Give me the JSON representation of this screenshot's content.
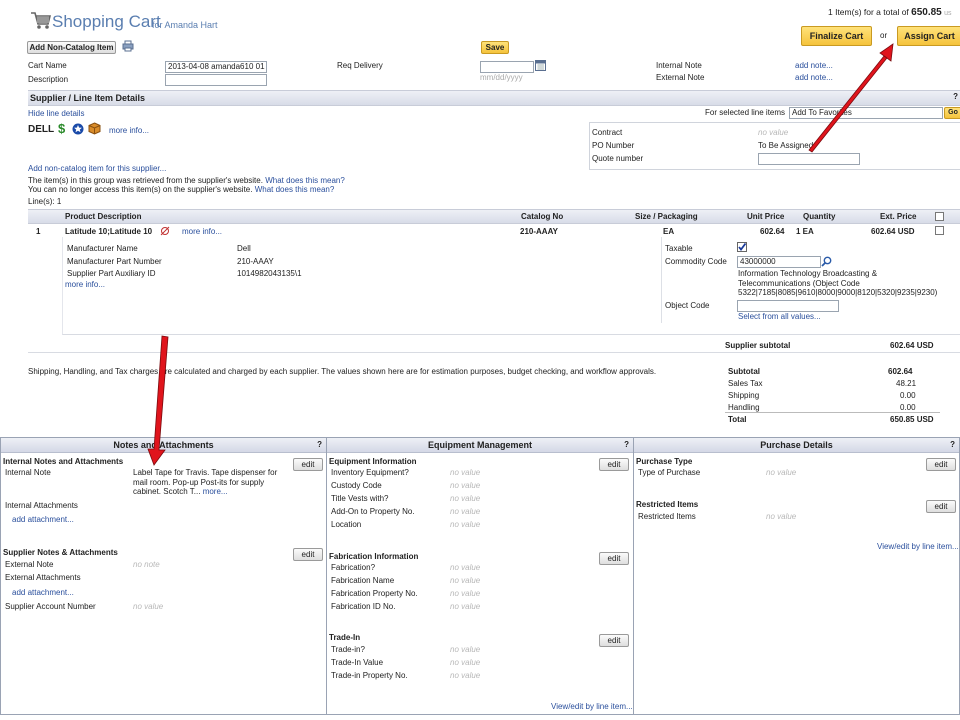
{
  "header": {
    "title": "Shopping Cart",
    "user": "for Amanda Hart",
    "summary_prefix": "1 Item(s)  for a total of",
    "total": "650.85",
    "currency": "us",
    "finalize_label": "Finalize Cart",
    "or": "or",
    "assign_label": "Assign Cart",
    "add_noncatalog_label": "Add Non-Catalog Item",
    "save_label": "Save"
  },
  "cart_form": {
    "cart_name_label": "Cart Name",
    "cart_name_value": "2013-04-08 amanda610 01",
    "description_label": "Description",
    "description_value": "",
    "req_delivery_label": "Req Delivery",
    "date_hint": "mm/dd/yyyy",
    "internal_note_label": "Internal Note",
    "external_note_label": "External Note",
    "add_note": "add note..."
  },
  "supplier_section": {
    "title": "Supplier / Line Item Details",
    "hide_link": "Hide line details",
    "selected_label": "For selected line items",
    "select_value": "Add To Favorites",
    "go_label": "Go",
    "supplier_name": "DELL",
    "more_info": "more info...",
    "add_noncat_link": "Add non-catalog item for this supplier...",
    "notice1": "The item(s) in this group was retrieved from the supplier's website.",
    "notice2": "You can no longer access this item(s) on the supplier's website.",
    "what_link": "What does this mean?",
    "lines": "Line(s): 1",
    "contract_label": "Contract",
    "contract_value": "no value",
    "po_label": "PO Number",
    "po_value": "To Be Assigned",
    "quote_label": "Quote number"
  },
  "table": {
    "headers": [
      "Product Description",
      "Catalog No",
      "Size / Packaging",
      "Unit Price",
      "Quantity",
      "Ext. Price"
    ],
    "row": {
      "num": "1",
      "desc": "Latitude 10;Latitude 10",
      "more_info": "more info...",
      "catalog": "210-AAAY",
      "size": "EA",
      "unit_price": "602.64",
      "quantity": "1 EA",
      "ext_price": "602.64 USD"
    },
    "details": {
      "mfr_name_label": "Manufacturer Name",
      "mfr_name": "Dell",
      "mfr_part_label": "Manufacturer Part Number",
      "mfr_part": "210-AAAY",
      "aux_label": "Supplier Part Auxiliary ID",
      "aux": "1014982043135\\1",
      "more_info": "more info...",
      "taxable_label": "Taxable",
      "commodity_label": "Commodity Code",
      "commodity_value": "43000000",
      "commodity_desc1": "Information Technology Broadcasting &",
      "commodity_desc2": "Telecommunications (Object Code",
      "commodity_desc3": "5322|7185|8085|9610|8000|9000|8120|5320|9235|9230)",
      "object_label": "Object Code",
      "select_all": "Select from all values..."
    },
    "supplier_subtotal_label": "Supplier subtotal",
    "supplier_subtotal": "602.64 USD"
  },
  "totals": {
    "note": "Shipping, Handling, and Tax charges are calculated and charged by each supplier. The values shown here are for estimation purposes, budget checking, and workflow approvals.",
    "subtotal_label": "Subtotal",
    "subtotal": "602.64",
    "tax_label": "Sales Tax",
    "tax": "48.21",
    "shipping_label": "Shipping",
    "shipping": "0.00",
    "handling_label": "Handling",
    "handling": "0.00",
    "total_label": "Total",
    "total": "650.85 USD"
  },
  "notes_panel": {
    "title": "Notes and Attachments",
    "q": "?",
    "edit": "edit",
    "internal_heading": "Internal Notes and Attachments",
    "internal_note_label": "Internal Note",
    "internal_note_1": "Label Tape for Travis. Tape dispenser for",
    "internal_note_2": "mail room. Pop-up Post-its for supply",
    "internal_note_3": "cabinet. Scotch T...",
    "more": "more...",
    "internal_attach_label": "Internal Attachments",
    "add_attachment": "add attachment...",
    "supplier_heading": "Supplier Notes & Attachments",
    "external_note_label": "External Note",
    "external_note_value": "no note",
    "external_attach_label": "External Attachments",
    "account_label": "Supplier Account Number",
    "account_value": "no value"
  },
  "equipment_panel": {
    "title": "Equipment Management",
    "q": "?",
    "edit": "edit",
    "equip_heading": "Equipment Information",
    "equip_fields": [
      "Inventory Equipment?",
      "Custody Code",
      "Title Vests with?",
      "Add-On to Property No.",
      "Location"
    ],
    "fab_heading": "Fabrication Information",
    "fab_fields": [
      "Fabrication?",
      "Fabrication Name",
      "Fabrication Property No.",
      "Fabrication ID No."
    ],
    "trade_heading": "Trade-In",
    "trade_fields": [
      "Trade-in?",
      "Trade-In Value",
      "Trade-in Property No."
    ],
    "no_value": "no value",
    "view_link": "View/edit by line item..."
  },
  "purchase_panel": {
    "title": "Purchase Details",
    "q": "?",
    "edit": "edit",
    "type_heading": "Purchase Type",
    "type_label": "Type of Purchase",
    "restricted_heading": "Restricted Items",
    "restricted_label": "Restricted Items",
    "no_value": "no value",
    "view_link": "View/edit by line item..."
  },
  "colors": {
    "accent_yellow": "#f5c33c",
    "link": "#2a4f9c",
    "arrow": "#e0141c"
  }
}
